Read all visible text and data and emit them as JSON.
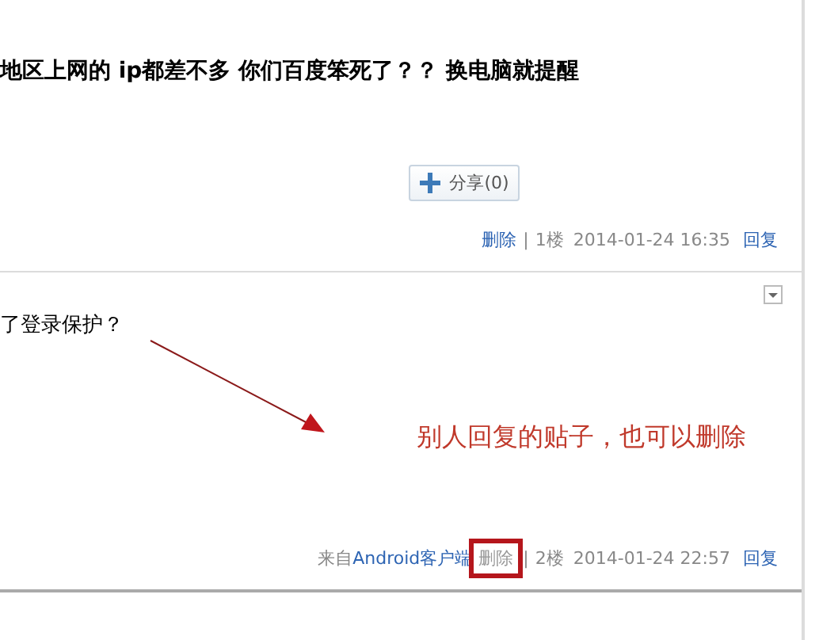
{
  "posts": [
    {
      "text": "地区上网的 ip都差不多 你们百度笨死了？？ 换电脑就提醒",
      "bold": true,
      "share": "分享(0)",
      "delete": "删除",
      "delete_highlighted": false,
      "separator": "|",
      "floor": "1楼",
      "time": "2014-01-24 16:35",
      "reply": "回复"
    },
    {
      "text": "了登录保护？",
      "bold": false,
      "menu": true,
      "source_prefix": "来自",
      "source_link": "Android客户端",
      "delete": "删除",
      "delete_highlighted": true,
      "separator": "|",
      "floor": "2楼",
      "time": "2014-01-24 22:57",
      "reply": "回复",
      "annotation": "别人回复的贴子，也可以删除"
    }
  ]
}
